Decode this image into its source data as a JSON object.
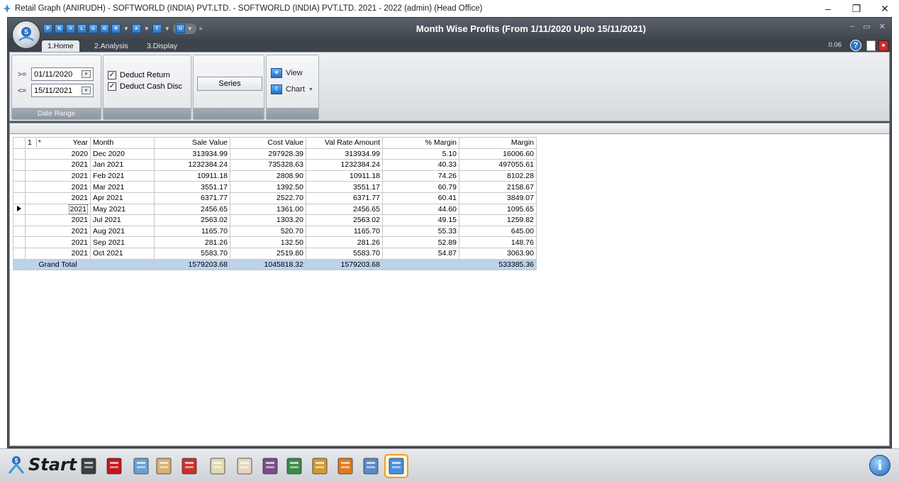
{
  "os_window": {
    "title": "Retail Graph (ANIRUDH) - SOFTWORLD (INDIA) PVT.LTD. - SOFTWORLD (INDIA) PVT.LTD.  2021 - 2022 (admin) (Head Office)",
    "controls": [
      "minimize-icon",
      "restore-icon",
      "close-icon"
    ]
  },
  "ribbon": {
    "form_title": "Month Wise Profits (From 1/11/2020 Upto 15/11/2021)",
    "qat_buttons": [
      "P",
      "N",
      "V",
      "L",
      "G",
      "O",
      "R",
      "A",
      "T",
      "U"
    ],
    "tabs": [
      {
        "label": "1.Home",
        "active": true
      },
      {
        "label": "2.Analysis",
        "active": false
      },
      {
        "label": "3.Display",
        "active": false
      }
    ],
    "version": "0.06",
    "date_range": {
      "caption": "Date Range",
      "from_op": ">=",
      "from_value": "01/11/2020",
      "to_op": "<=",
      "to_value": "15/11/2021"
    },
    "options": {
      "deduct_return": {
        "label": "Deduct Return",
        "checked": true
      },
      "deduct_cash_disc": {
        "label": "Deduct Cash Disc",
        "checked": true
      }
    },
    "series_label": "Series",
    "view_label": "View",
    "chart_label": "Chart"
  },
  "grid": {
    "header_cells": {
      "level": "1",
      "star": "*"
    },
    "columns": [
      "Year",
      "Month",
      "Sale Value",
      "Cost Value",
      "Val Rate Amount",
      "% Margin",
      "Margin"
    ],
    "rows": [
      {
        "year": "2020",
        "month": "Dec 2020",
        "sale": "313934.99",
        "cost": "297928.39",
        "valrate": "313934.99",
        "pct": "5.10",
        "margin": "16006.60"
      },
      {
        "year": "2021",
        "month": "Jan 2021",
        "sale": "1232384.24",
        "cost": "735328.63",
        "valrate": "1232384.24",
        "pct": "40.33",
        "margin": "497055.61"
      },
      {
        "year": "2021",
        "month": "Feb 2021",
        "sale": "10911.18",
        "cost": "2808.90",
        "valrate": "10911.18",
        "pct": "74.26",
        "margin": "8102.28"
      },
      {
        "year": "2021",
        "month": "Mar 2021",
        "sale": "3551.17",
        "cost": "1392.50",
        "valrate": "3551.17",
        "pct": "60.79",
        "margin": "2158.67"
      },
      {
        "year": "2021",
        "month": "Apr 2021",
        "sale": "6371.77",
        "cost": "2522.70",
        "valrate": "6371.77",
        "pct": "60.41",
        "margin": "3849.07"
      },
      {
        "year": "2021",
        "month": "May 2021",
        "sale": "2456.65",
        "cost": "1361.00",
        "valrate": "2456.65",
        "pct": "44.60",
        "margin": "1095.65"
      },
      {
        "year": "2021",
        "month": "Jul 2021",
        "sale": "2563.02",
        "cost": "1303.20",
        "valrate": "2563.02",
        "pct": "49.15",
        "margin": "1259.82"
      },
      {
        "year": "2021",
        "month": "Aug 2021",
        "sale": "1165.70",
        "cost": "520.70",
        "valrate": "1165.70",
        "pct": "55.33",
        "margin": "645.00"
      },
      {
        "year": "2021",
        "month": "Sep 2021",
        "sale": "281.26",
        "cost": "132.50",
        "valrate": "281.26",
        "pct": "52.89",
        "margin": "148.76"
      },
      {
        "year": "2021",
        "month": "Oct 2021",
        "sale": "5583.70",
        "cost": "2519.80",
        "valrate": "5583.70",
        "pct": "54.87",
        "margin": "3063.90"
      }
    ],
    "current_row_index": 5,
    "total": {
      "label": "Grand Total",
      "sale": "1579203.68",
      "cost": "1045818.32",
      "valrate": "1579203.68",
      "pct": "",
      "margin": "533385.36"
    }
  },
  "taskbar": {
    "start_label": "Start",
    "icons": [
      "calculator-icon",
      "red-book-icon",
      "bottle-icon",
      "cheque-book-icon",
      "powerpoint-icon",
      "re-document-icon",
      "pe-document-icon",
      "tools-icon",
      "barcode-icon",
      "money-bag-icon",
      "boxes-icon",
      "printer-icon",
      "copy-documents-icon"
    ],
    "info_label": "i"
  }
}
